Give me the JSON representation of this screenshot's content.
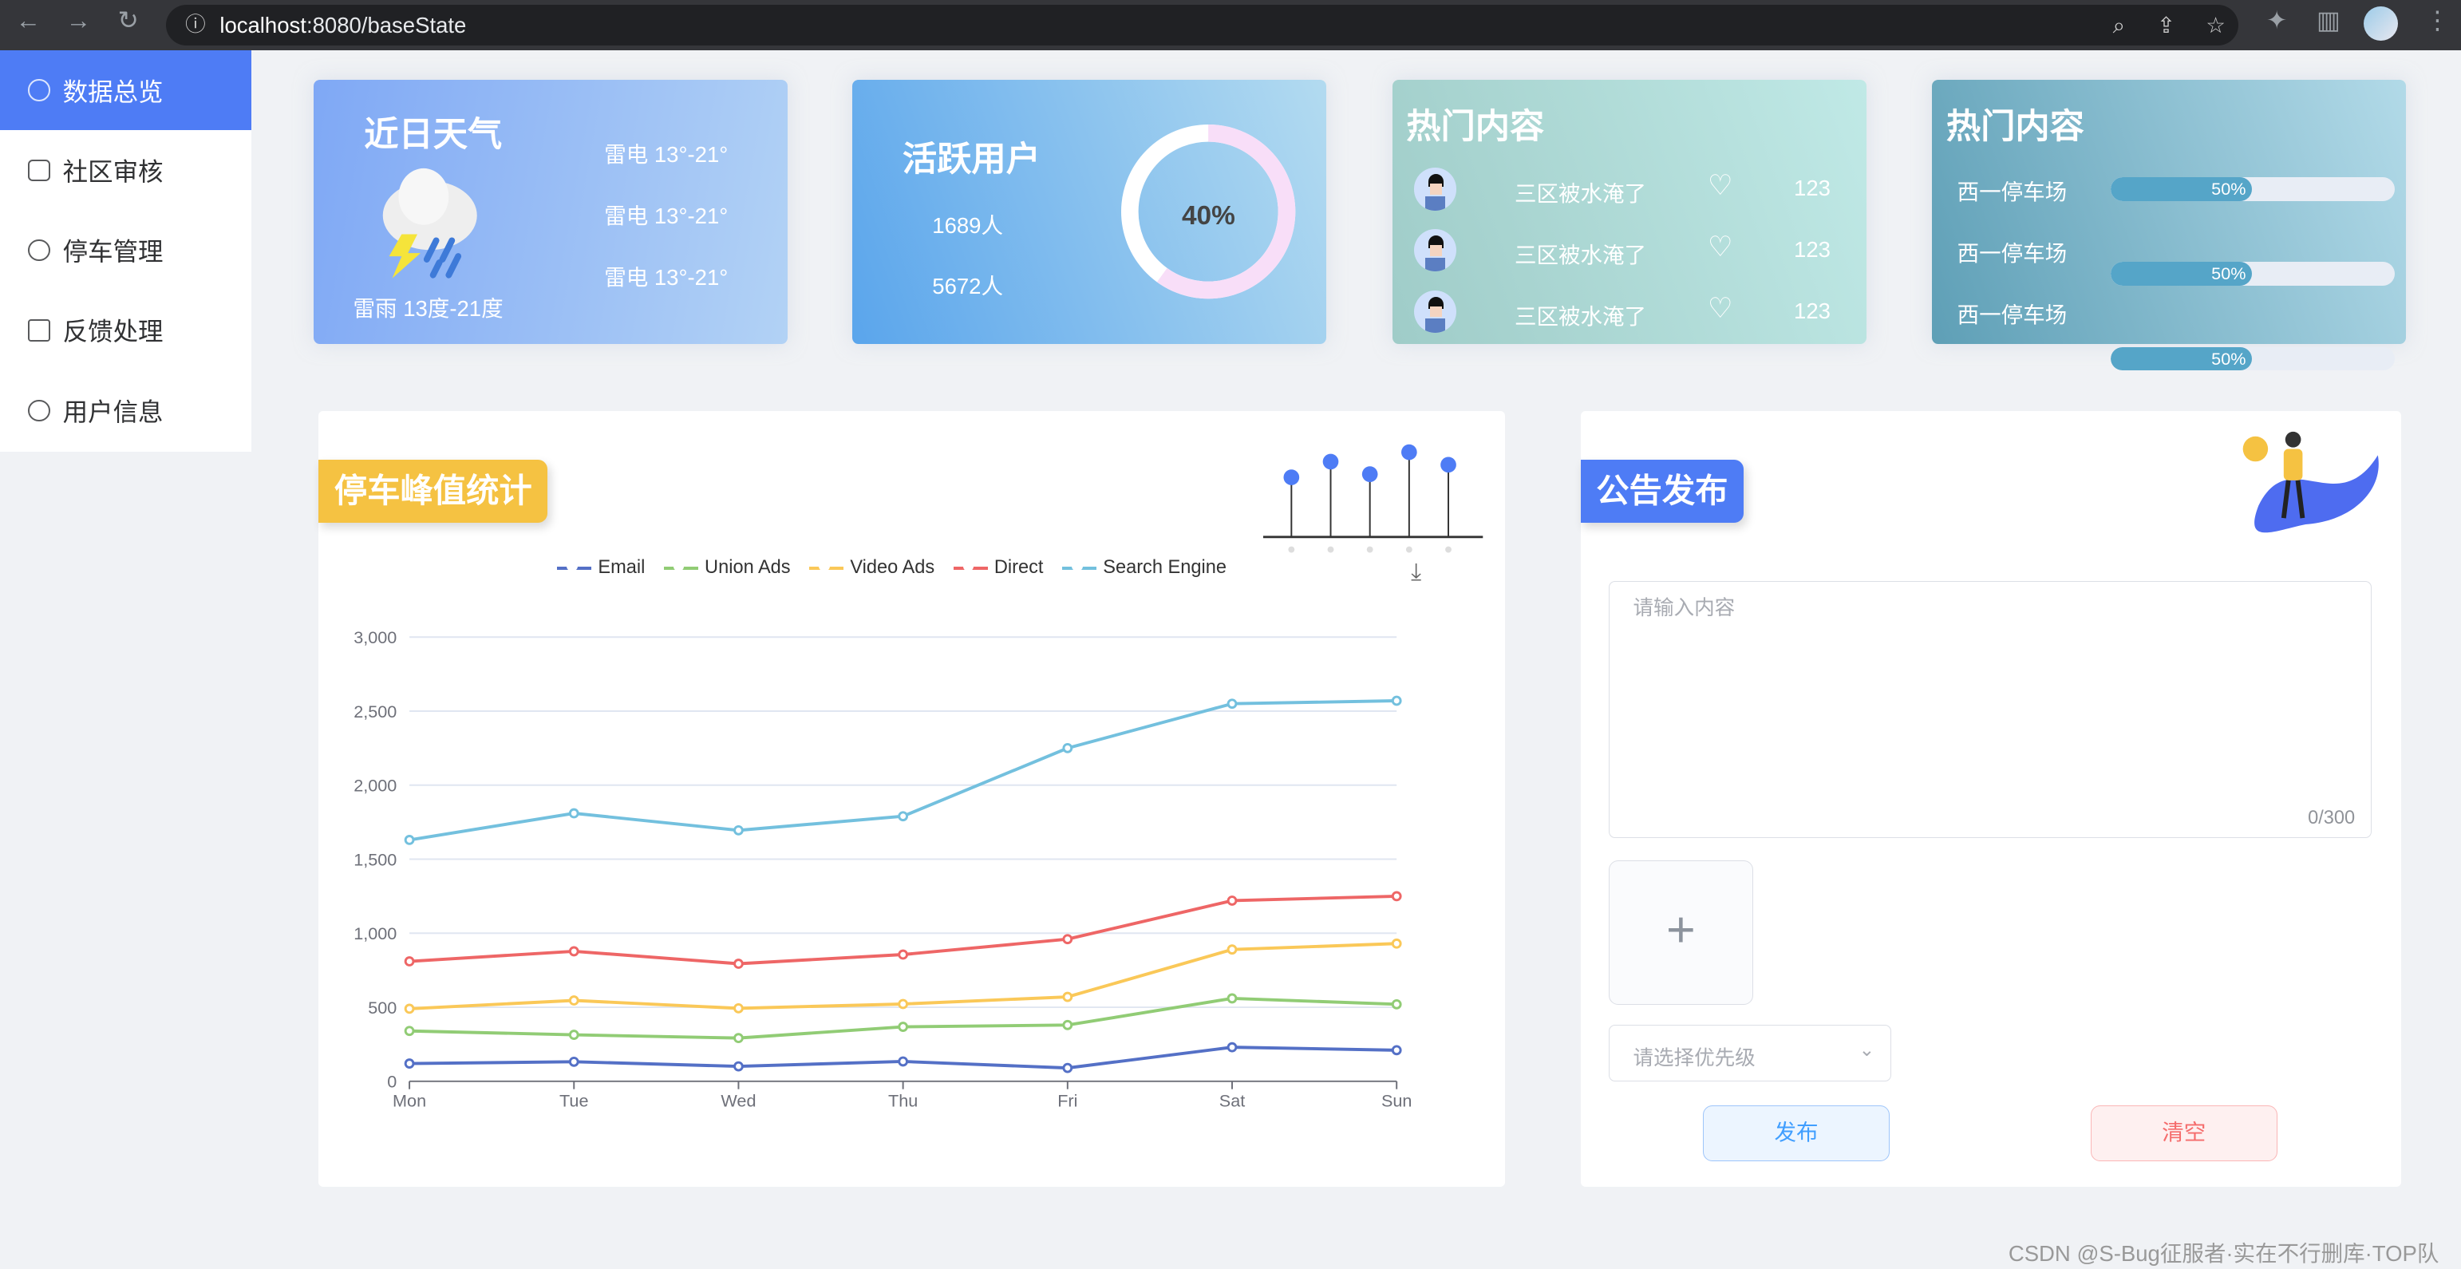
{
  "browser": {
    "url_host": "localhost",
    "url_path": ":8080/baseState"
  },
  "sidebar": {
    "items": [
      {
        "label": "数据总览",
        "active": true
      },
      {
        "label": "社区审核"
      },
      {
        "label": "停车管理"
      },
      {
        "label": "反馈处理"
      },
      {
        "label": "用户信息"
      }
    ]
  },
  "weather": {
    "title": "近日天气",
    "summary": "雷雨 13度-21度",
    "forecast": [
      "雷电 13°-21°",
      "雷电 13°-21°",
      "雷电 13°-21°"
    ]
  },
  "active_users": {
    "title": "活跃用户",
    "counts": [
      "1689人",
      "5672人"
    ],
    "percent_label": "40%",
    "percent": 40
  },
  "hot_content": {
    "title": "热门内容",
    "items": [
      {
        "text": "三区被水淹了",
        "likes": "123"
      },
      {
        "text": "三区被水淹了",
        "likes": "123"
      },
      {
        "text": "三区被水淹了",
        "likes": "123"
      }
    ]
  },
  "hot_parking": {
    "title": "热门内容",
    "items": [
      {
        "name": "西一停车场",
        "label": "50%",
        "value": 50
      },
      {
        "name": "西一停车场",
        "label": "50%",
        "value": 50
      },
      {
        "name": "西一停车场",
        "label": "50%",
        "value": 50
      }
    ]
  },
  "chart_panel": {
    "tag": "停车峰值统计"
  },
  "chart_data": {
    "type": "line",
    "stacked": true,
    "categories": [
      "Mon",
      "Tue",
      "Wed",
      "Thu",
      "Fri",
      "Sat",
      "Sun"
    ],
    "yticks": [
      "0",
      "500",
      "1,000",
      "1,500",
      "2,000",
      "2,500",
      "3,000"
    ],
    "ylim": [
      0,
      3000
    ],
    "grid": true,
    "legend": "top",
    "series": [
      {
        "name": "Email",
        "color": "#5470c6",
        "values": [
          120,
          132,
          101,
          134,
          90,
          230,
          210
        ]
      },
      {
        "name": "Union Ads",
        "color": "#91cc75",
        "values": [
          220,
          182,
          191,
          234,
          290,
          330,
          310
        ]
      },
      {
        "name": "Video Ads",
        "color": "#fac858",
        "values": [
          150,
          232,
          201,
          154,
          190,
          330,
          410
        ]
      },
      {
        "name": "Direct",
        "color": "#ee6666",
        "values": [
          320,
          332,
          301,
          334,
          390,
          330,
          320
        ]
      },
      {
        "name": "Search Engine",
        "color": "#73c0de",
        "values": [
          820,
          932,
          901,
          934,
          1290,
          1330,
          1320
        ]
      }
    ]
  },
  "notice": {
    "tag": "公告发布",
    "placeholder": "请输入内容",
    "counter": "0/300",
    "priority_placeholder": "请选择优先级",
    "publish": "发布",
    "clear": "清空"
  },
  "watermark": "CSDN @S-Bug征服者·实在不行删库·TOP队"
}
